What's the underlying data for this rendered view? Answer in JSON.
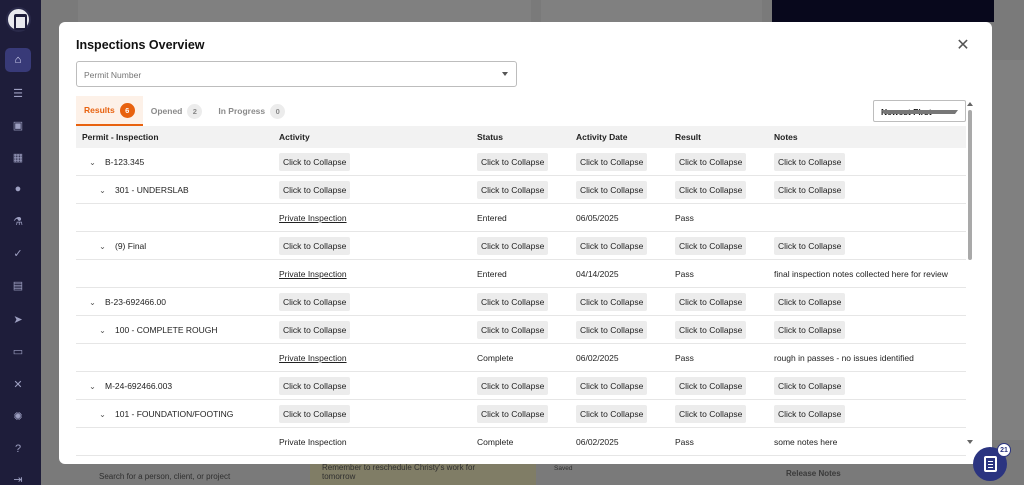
{
  "modal": {
    "title": "Inspections Overview",
    "permit_placeholder": "Permit Number",
    "sort_value": "Newest First"
  },
  "tabs": [
    {
      "label": "Results",
      "count": "6"
    },
    {
      "label": "Opened",
      "count": "2"
    },
    {
      "label": "In Progress",
      "count": "0"
    }
  ],
  "columns": [
    "Permit - Inspection",
    "Activity",
    "Status",
    "Activity Date",
    "Result",
    "Notes"
  ],
  "collapse_label": "Click to Collapse",
  "rows": [
    {
      "level": 0,
      "label": "B-123.345"
    },
    {
      "level": 1,
      "label": "301 - UNDERSLAB"
    },
    {
      "activity": "Private Inspection",
      "status": "Entered",
      "date": "06/05/2025",
      "result": "Pass",
      "notes": ""
    },
    {
      "level": 1,
      "label": "(9) Final"
    },
    {
      "activity": "Private Inspection",
      "status": "Entered",
      "date": "04/14/2025",
      "result": "Pass",
      "notes": "final inspection notes collected here for review"
    },
    {
      "level": 0,
      "label": "B-23-692466.00"
    },
    {
      "level": 1,
      "label": "100 - COMPLETE ROUGH"
    },
    {
      "activity": "Private Inspection",
      "status": "Complete",
      "date": "06/02/2025",
      "result": "Pass",
      "notes": "rough in passes - no issues identified"
    },
    {
      "level": 0,
      "label": "M-24-692466.003"
    },
    {
      "level": 1,
      "label": "101 - FOUNDATION/FOOTING"
    },
    {
      "activity": "Private Inspection",
      "status": "Complete",
      "date": "06/02/2025",
      "result": "Pass",
      "notes": "some notes here"
    }
  ],
  "background": {
    "search_placeholder": "Search for a person, client, or project",
    "reminder": "Remember to reschedule Christy's work for tomorrow",
    "saved": "Saved",
    "release_notes": "Release Notes"
  },
  "fab": {
    "count": "21"
  },
  "icons": {
    "nav": [
      "home-icon",
      "list-icon",
      "briefcase-icon",
      "calendar-icon",
      "person-icon",
      "flask-icon",
      "check-circle-icon",
      "clipboard-icon",
      "send-icon",
      "card-icon",
      "tools-icon",
      "gear-icon",
      "help-icon",
      "logout-icon"
    ],
    "close": "close-icon"
  },
  "colors": {
    "accent": "#e8620f",
    "rail": "#1e1d3a",
    "fab": "#2b3480"
  }
}
